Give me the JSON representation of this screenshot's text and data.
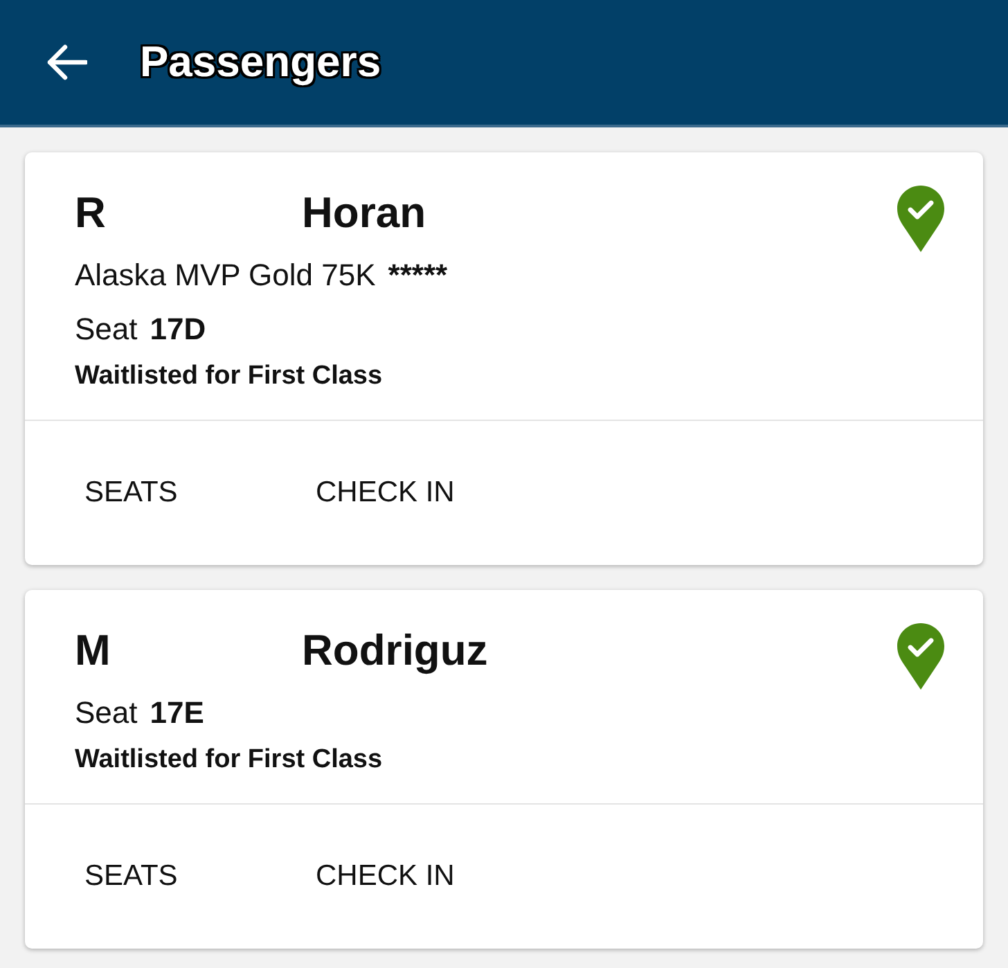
{
  "header": {
    "title": "Passengers"
  },
  "passengers": [
    {
      "first_name": "R",
      "last_name": "Horan",
      "tier": "Alaska MVP Gold 75K",
      "tier_stars": "*****",
      "seat_label": "Seat",
      "seat": "17D",
      "status": "Waitlisted for First Class",
      "actions": [
        "SEATS",
        "CHECK IN"
      ]
    },
    {
      "first_name": "M",
      "last_name": "Rodriguz",
      "seat_label": "Seat",
      "seat": "17E",
      "status": "Waitlisted for First Class",
      "actions": [
        "SEATS",
        "CHECK IN"
      ]
    }
  ]
}
